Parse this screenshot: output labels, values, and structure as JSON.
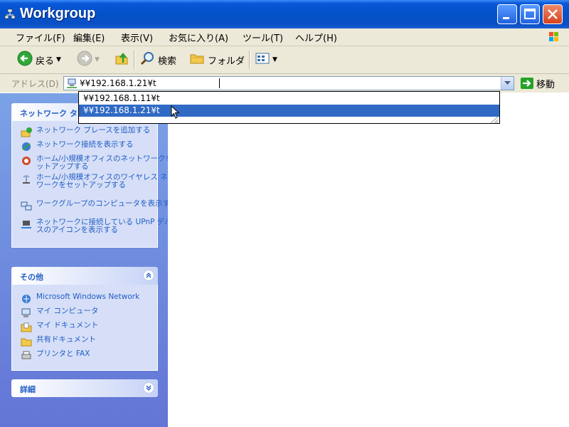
{
  "window": {
    "title": "Workgroup"
  },
  "menu": {
    "items": [
      "ファイル(F)",
      "編集(E)",
      "表示(V)",
      "お気に入り(A)",
      "ツール(T)",
      "ヘルプ(H)"
    ]
  },
  "toolbar": {
    "back_label": "戻る",
    "search_label": "検索",
    "folders_label": "フォルダ"
  },
  "address": {
    "label": "アドレス(D)",
    "value": "¥¥192.168.1.21¥t",
    "go_label": "移動",
    "suggestions": [
      "¥¥192.168.1.11¥t",
      "¥¥192.168.1.21¥t"
    ],
    "selected_index": 1
  },
  "taskpane": {
    "network_tasks": {
      "title": "ネットワーク タスク",
      "items": [
        {
          "label": "ネットワーク プレースを追加する",
          "icon": "add-network-place-icon"
        },
        {
          "label": "ネットワーク接続を表示する",
          "icon": "network-connections-icon"
        },
        {
          "label": "ホーム/小規模オフィスのネットワークをセットアップする",
          "icon": "home-network-setup-icon"
        },
        {
          "label": "ホーム/小規模オフィスのワイヤレス ネットワークをセットアップする",
          "icon": "wireless-setup-icon"
        },
        {
          "label": "ワークグループのコンピュータを表示する",
          "icon": "workgroup-computers-icon"
        },
        {
          "label": "ネットワークに接続している UPnP デバイスのアイコンを表示する",
          "icon": "upnp-devices-icon"
        }
      ]
    },
    "other": {
      "title": "その他",
      "items": [
        {
          "label": "Microsoft Windows Network",
          "icon": "windows-network-icon"
        },
        {
          "label": "マイ コンピュータ",
          "icon": "my-computer-icon"
        },
        {
          "label": "マイ ドキュメント",
          "icon": "my-documents-icon"
        },
        {
          "label": "共有ドキュメント",
          "icon": "shared-documents-icon"
        },
        {
          "label": "プリンタと FAX",
          "icon": "printers-fax-icon"
        }
      ]
    },
    "details": {
      "title": "詳細"
    }
  },
  "colors": {
    "titlebar": "#0451c9",
    "selection": "#316ac5",
    "taskpane_link": "#215dc6",
    "menubar": "#ece9d8"
  }
}
